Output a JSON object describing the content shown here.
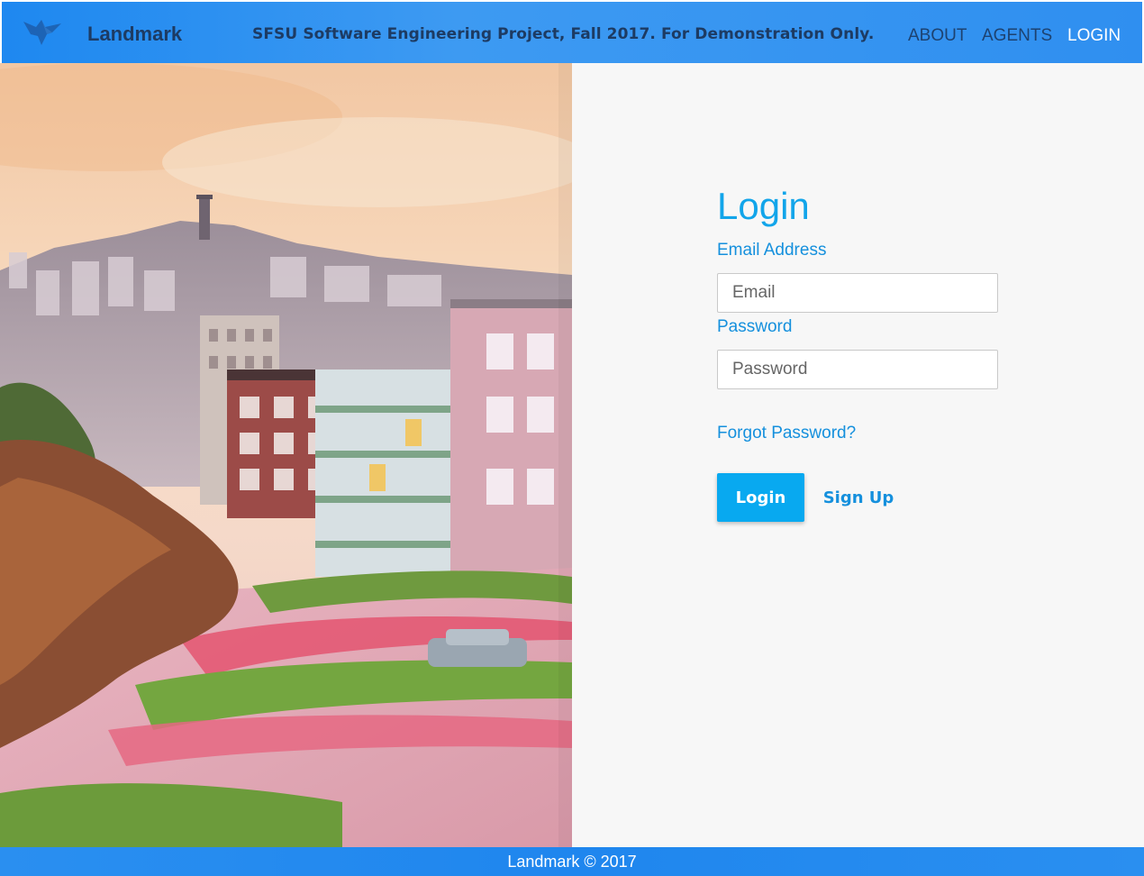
{
  "header": {
    "brand": "Landmark",
    "banner": "SFSU Software Engineering Project, Fall 2017. For Demonstration Only.",
    "nav": {
      "about": "ABOUT",
      "agents": "AGENTS",
      "login": "LOGIN"
    },
    "active_nav": "LOGIN",
    "logo_icon": "bird-icon"
  },
  "hero": {
    "image_subject": "san-francisco-lombard-street-photo"
  },
  "login": {
    "title": "Login",
    "email_label": "Email Address",
    "email_placeholder": "Email",
    "email_value": "",
    "password_label": "Password",
    "password_placeholder": "Password",
    "password_value": "",
    "forgot_link": "Forgot Password?",
    "login_button": "Login",
    "signup_button": "Sign Up"
  },
  "footer": {
    "text": "Landmark © 2017"
  },
  "colors": {
    "header_bg": "#2f8ff0",
    "accent": "#08a9f0",
    "link": "#1590dd",
    "panel_bg": "#f7f7f7"
  }
}
